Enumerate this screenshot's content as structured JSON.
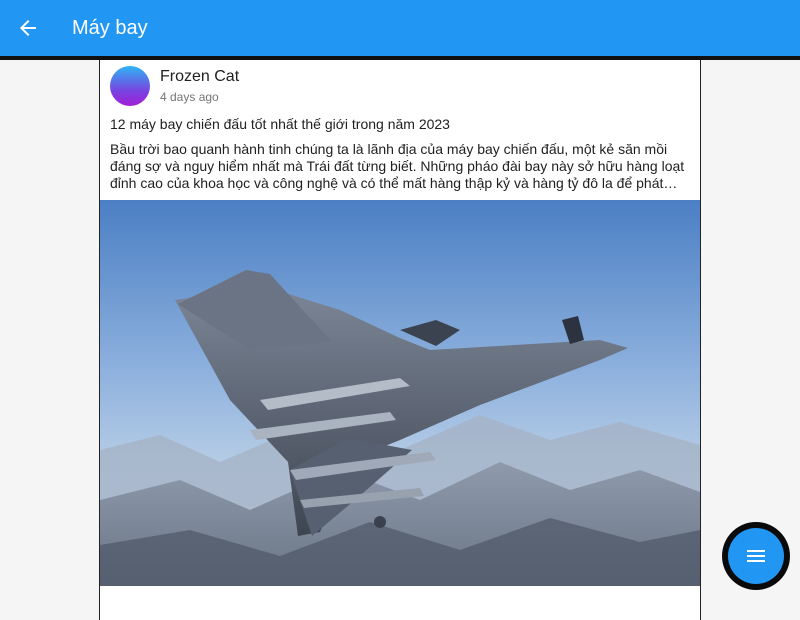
{
  "appbar": {
    "title": "Máy bay",
    "color": "#2196f3",
    "back_icon": "arrow-back-icon"
  },
  "post": {
    "author": "Frozen Cat",
    "time": "4 days ago",
    "title": "12 máy bay chiến đấu tốt nhất thế giới trong năm 2023",
    "body": "Bầu trời bao quanh hành tinh chúng ta là lãnh địa của máy bay chiến đấu, một kẻ săn mồi đáng sợ và nguy hiểm nhất mà Trái đất từng biết. Những pháo đài bay này sở hữu hàng loạt đỉnh cao của khoa học và công nghệ và có thể mất hàng thập kỷ và hàng tỷ đô la để phát triển."
  },
  "fab": {
    "icon": "menu-icon",
    "color": "#2196f3"
  }
}
